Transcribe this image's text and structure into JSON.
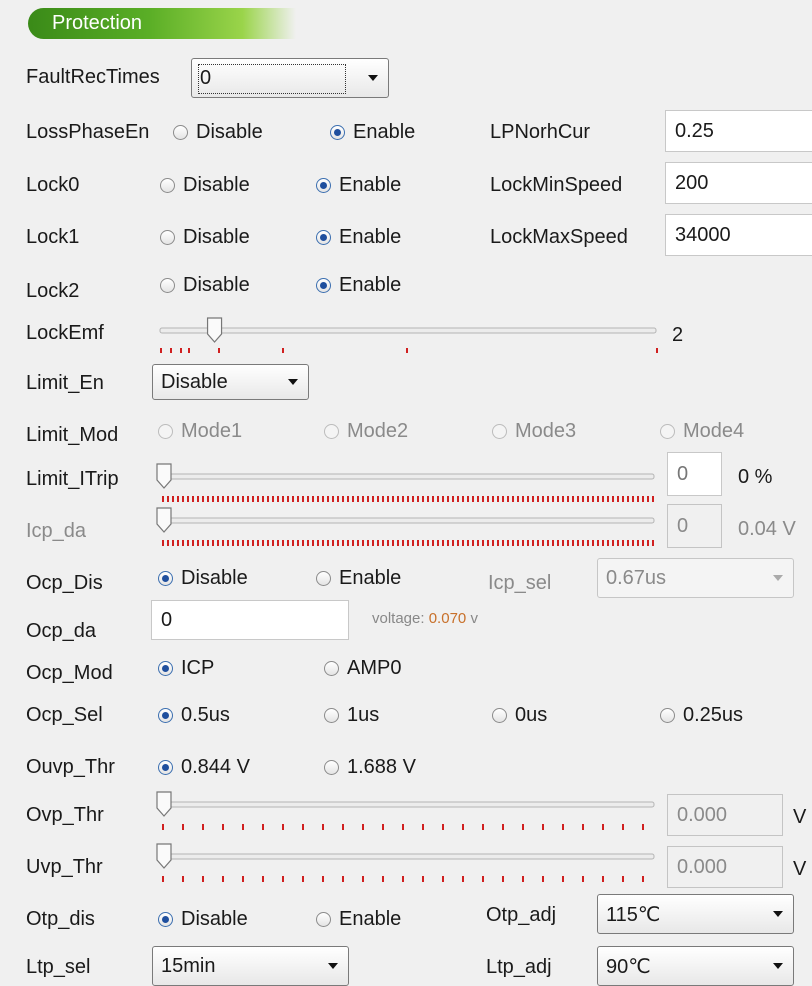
{
  "section": {
    "title": "Protection"
  },
  "fault_rec_times": {
    "label": "FaultRecTimes",
    "value": "0"
  },
  "loss_phase_en": {
    "label": "LossPhaseEn",
    "opt1": "Disable",
    "opt2": "Enable",
    "selected": "Enable"
  },
  "lp_norh_cur": {
    "label": "LPNorhCur",
    "value": "0.25"
  },
  "lock0": {
    "label": "Lock0",
    "opt1": "Disable",
    "opt2": "Enable",
    "selected": "Enable"
  },
  "lock_min_speed": {
    "label": "LockMinSpeed",
    "value": "200"
  },
  "lock1": {
    "label": "Lock1",
    "opt1": "Disable",
    "opt2": "Enable",
    "selected": "Enable"
  },
  "lock_max_speed": {
    "label": "LockMaxSpeed",
    "value": "34000"
  },
  "lock2": {
    "label": "Lock2",
    "opt1": "Disable",
    "opt2": "Enable",
    "selected": "Enable"
  },
  "lock_emf": {
    "label": "LockEmf",
    "value_text": "2",
    "level": 0.11
  },
  "limit_en": {
    "label": "Limit_En",
    "value": "Disable"
  },
  "limit_mod": {
    "label": "Limit_Mod",
    "options": [
      "Mode1",
      "Mode2",
      "Mode3",
      "Mode4"
    ]
  },
  "limit_itrip": {
    "label": "Limit_ITrip",
    "value": "0",
    "readout": "0 %",
    "level": 0
  },
  "icp_da": {
    "label": "Icp_da",
    "value": "0",
    "readout": "0.04 V",
    "level": 0
  },
  "ocp_dis": {
    "label": "Ocp_Dis",
    "opt1": "Disable",
    "opt2": "Enable",
    "selected": "Disable"
  },
  "icp_sel": {
    "label": "Icp_sel",
    "value": "0.67us"
  },
  "ocp_da": {
    "label": "Ocp_da",
    "value": "0",
    "voltage_label": "voltage:",
    "voltage_value": "0.070",
    "voltage_unit": "v"
  },
  "ocp_mod": {
    "label": "Ocp_Mod",
    "opt1": "ICP",
    "opt2": "AMP0",
    "selected": "ICP"
  },
  "ocp_sel": {
    "label": "Ocp_Sel",
    "options": [
      "0.5us",
      "1us",
      "0us",
      "0.25us"
    ],
    "selected": "0.5us"
  },
  "ouvp_thr": {
    "label": "Ouvp_Thr",
    "opt1": "0.844 V",
    "opt2": "1.688 V",
    "selected": "0.844 V"
  },
  "ovp_thr": {
    "label": "Ovp_Thr",
    "value": "0.000",
    "unit": "V",
    "level": 0
  },
  "uvp_thr": {
    "label": "Uvp_Thr",
    "value": "0.000",
    "unit": "V",
    "level": 0
  },
  "otp_dis": {
    "label": "Otp_dis",
    "opt1": "Disable",
    "opt2": "Enable",
    "selected": "Disable"
  },
  "otp_adj": {
    "label": "Otp_adj",
    "value": "115℃"
  },
  "ltp_sel": {
    "label": "Ltp_sel",
    "value": "15min"
  },
  "ltp_adj": {
    "label": "Ltp_adj",
    "value": "90℃"
  },
  "colors": {
    "header_green": "#4e9e22",
    "tick_red": "#d02020",
    "radio_blue": "#1f4f9e",
    "voltage_orange": "#c8702a"
  }
}
